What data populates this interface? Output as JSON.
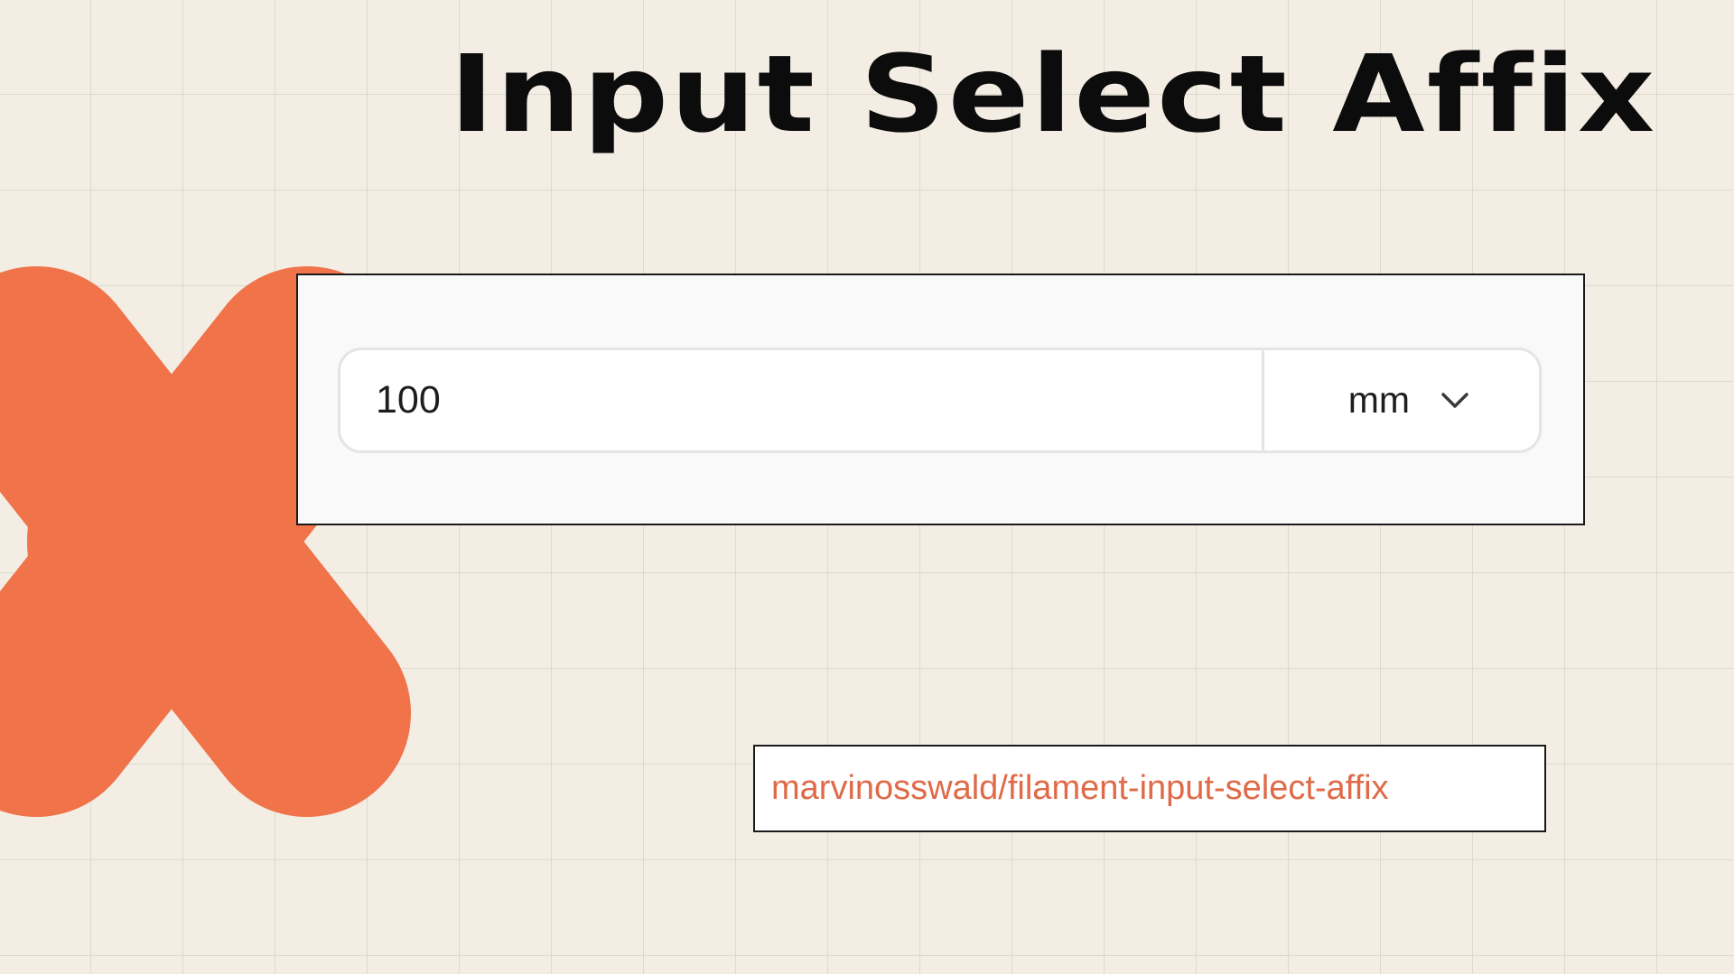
{
  "page": {
    "title": "Input Select Affix",
    "background_color": "#f3ede4",
    "grid_color": "#c6ceba",
    "accent_color": "#f0734a"
  },
  "demo": {
    "input_value": "100",
    "unit_selected": "mm",
    "unit_select_icon": "chevron-down-icon"
  },
  "footer": {
    "repository": "marvinosswald/filament-input-select-affix",
    "repository_color": "#e06a47"
  }
}
